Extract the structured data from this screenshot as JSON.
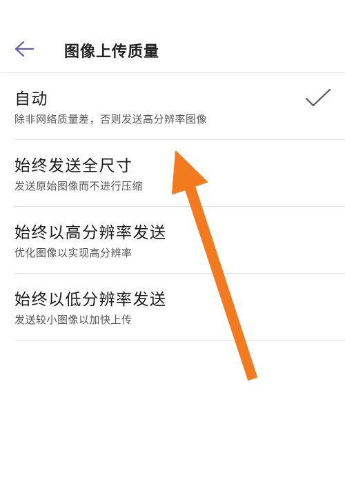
{
  "header": {
    "title": "图像上传质量",
    "back_icon": "arrow-left-icon"
  },
  "options": [
    {
      "title": "自动",
      "subtitle": "除非网络质量差，否则发送高分辨率图像",
      "selected": true
    },
    {
      "title": "始终发送全尺寸",
      "subtitle": "发送原始图像而不进行压缩",
      "selected": false
    },
    {
      "title": "始终以高分辨率发送",
      "subtitle": "优化图像以实现高分辨率",
      "selected": false
    },
    {
      "title": "始终以低分辨率发送",
      "subtitle": "发送较小图像以加快上传",
      "selected": false
    }
  ],
  "colors": {
    "accent": "#6b5ea8",
    "check": "#555555",
    "annotation_arrow": "#f47a20",
    "divider": "#e2e2e2"
  },
  "icons": {
    "selected": "check-icon"
  }
}
